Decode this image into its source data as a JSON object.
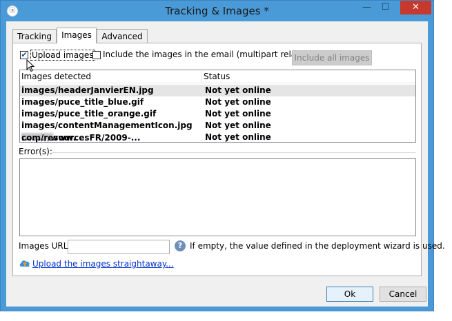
{
  "window": {
    "title": "Tracking & Images *",
    "app_icon": "adobe-campaign-icon",
    "minimize_glyph": "—",
    "maximize_glyph": "☐",
    "close_glyph": "✕"
  },
  "tabs": [
    {
      "label": "Tracking",
      "active": false
    },
    {
      "label": "Images",
      "active": true
    },
    {
      "label": "Advanced",
      "active": false
    }
  ],
  "options": {
    "upload_images_label": "Upload images",
    "upload_images_checked": true,
    "include_multipart_label": "Include the images in the email (multipart related)",
    "include_multipart_checked": false,
    "include_all_button": "Include all images"
  },
  "images_table": {
    "columns": [
      "Images detected",
      "Status"
    ],
    "rows": [
      {
        "image": "images/headerJanvierEN.jpg",
        "status": "Not yet online",
        "selected": true
      },
      {
        "image": "images/puce_title_blue.gif",
        "status": "Not yet online",
        "selected": false
      },
      {
        "image": "images/puce_title_orange.gif",
        "status": "Not yet online",
        "selected": false
      },
      {
        "image": "images/contentManagementIcon.jpg",
        "status": "Not yet online",
        "selected": false
      },
      {
        "image_prefix": "http://www.",
        "image_suffix": "com/resourcesFR/2009-...",
        "status": "Not yet online",
        "selected": false
      }
    ]
  },
  "errors": {
    "label": "Error(s):",
    "content": ""
  },
  "images_url": {
    "label": "Images URL:",
    "value": "",
    "hint": "If empty, the value defined in the deployment wizard is used."
  },
  "upload_link": "Upload the images straightaway...",
  "buttons": {
    "ok": "Ok",
    "cancel": "Cancel"
  }
}
